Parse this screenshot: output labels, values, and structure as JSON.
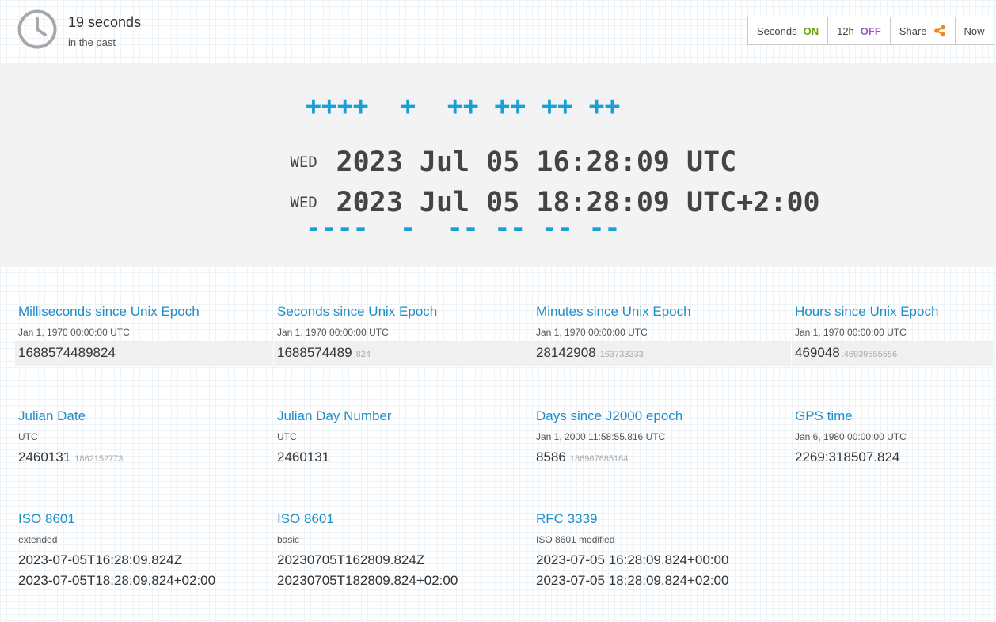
{
  "header": {
    "relative_value": "19 seconds",
    "relative_label": "in the past",
    "toolbar": {
      "seconds_label": "Seconds",
      "seconds_state": "ON",
      "hour_label": "12h",
      "hour_state": "OFF",
      "share_label": "Share",
      "now_label": "Now"
    }
  },
  "main": {
    "plus_row": "++++  +  ++ ++ ++ ++",
    "minus_row": "----  -  -- -- -- --",
    "utc": {
      "dow": "WED",
      "datetime": "2023 Jul 05 16:28:09 UTC"
    },
    "local": {
      "dow": "WED",
      "datetime": "2023 Jul 05 18:28:09 UTC+2:00"
    }
  },
  "cards": {
    "ms_epoch": {
      "title": "Milliseconds since Unix Epoch",
      "sub": "Jan 1, 1970 00:00:00 UTC",
      "value": "1688574489824",
      "frac": ""
    },
    "s_epoch": {
      "title": "Seconds since Unix Epoch",
      "sub": "Jan 1, 1970 00:00:00 UTC",
      "value": "1688574489",
      "frac": ".824"
    },
    "min_epoch": {
      "title": "Minutes since Unix Epoch",
      "sub": "Jan 1, 1970 00:00:00 UTC",
      "value": "28142908",
      "frac": ".163733333"
    },
    "hr_epoch": {
      "title": "Hours since Unix Epoch",
      "sub": "Jan 1, 1970 00:00:00 UTC",
      "value": "469048",
      "frac": ".46939555556"
    },
    "julian_date": {
      "title": "Julian Date",
      "sub": "UTC",
      "value": "2460131",
      "frac": ".1862152773"
    },
    "julian_day": {
      "title": "Julian Day Number",
      "sub": "UTC",
      "value": "2460131",
      "frac": ""
    },
    "j2000": {
      "title": "Days since J2000 epoch",
      "sub": "Jan 1, 2000 11:58:55.816 UTC",
      "value": "8586",
      "frac": ".186967685184"
    },
    "gps": {
      "title": "GPS time",
      "sub": "Jan 6, 1980 00:00:00 UTC",
      "value": "2269:318507.824",
      "frac": ""
    },
    "iso_ext": {
      "title": "ISO 8601",
      "sub": "extended",
      "line1": "2023-07-05T16:28:09.824Z",
      "line2": "2023-07-05T18:28:09.824+02:00"
    },
    "iso_basic": {
      "title": "ISO 8601",
      "sub": "basic",
      "line1": "20230705T162809.824Z",
      "line2": "20230705T182809.824+02:00"
    },
    "rfc3339": {
      "title": "RFC 3339",
      "sub": "ISO 8601 modified",
      "line1": "2023-07-05 16:28:09.824+00:00",
      "line2": "2023-07-05 18:28:09.824+02:00"
    }
  },
  "colors": {
    "accent": "#1a9fd6",
    "link": "#1f8ec7",
    "on": "#6aa30f",
    "off": "#9b57c9",
    "share_icon": "#f0861f"
  },
  "icons": {
    "clock": "clock-icon",
    "share": "share-icon"
  }
}
